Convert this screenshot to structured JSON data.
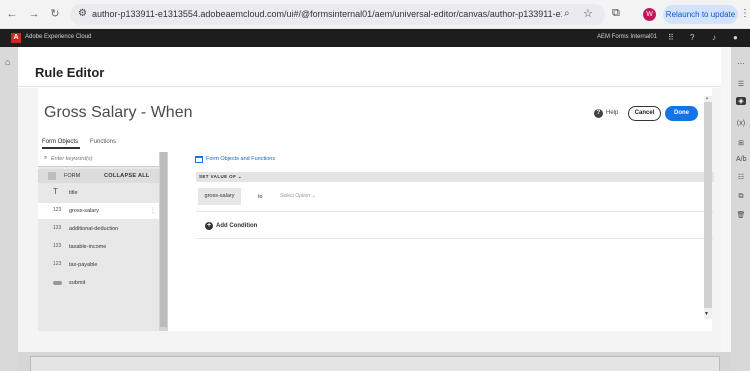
{
  "browser": {
    "url": "author-p133911-e1313554.adobeaemcloud.com/ui#/@formsinternal01/aem/universal-editor/canvas/author-p133911-e13135...",
    "profile_initial": "W",
    "relaunch_label": "Relaunch to update"
  },
  "adobe_bar": {
    "product_name": "Adobe Experience Cloud",
    "org_name": "AEM Forms Internal01"
  },
  "dialog": {
    "title": "Rule Editor"
  },
  "editor": {
    "rule_title": "Gross Salary - When",
    "help_label": "Help",
    "cancel_label": "Cancel",
    "done_label": "Done",
    "tabs": [
      {
        "label": "Form Objects",
        "active": true
      },
      {
        "label": "Functions",
        "active": false
      }
    ],
    "search_placeholder": "Enter keyword(s)",
    "tree_header": {
      "form_label": "FORM",
      "collapse_label": "COLLAPSE ALL"
    },
    "tree_items": [
      {
        "icon": "T",
        "label": "title",
        "selected": false
      },
      {
        "icon": "123",
        "label": "gross-salary",
        "selected": true
      },
      {
        "icon": "123",
        "label": "additional-deduction",
        "selected": false
      },
      {
        "icon": "123",
        "label": "taxable-income",
        "selected": false
      },
      {
        "icon": "123",
        "label": "tax-payable",
        "selected": false
      },
      {
        "icon": "button-icon",
        "label": "submit",
        "selected": false
      }
    ],
    "form_objects_link": "Form Objects and Functions",
    "set_value_label": "SET VALUE OF ⌄",
    "field_chip": "gross-salary",
    "to_label": "to",
    "select_option": "Select Option ⌄",
    "add_condition_label": "Add Condition"
  }
}
